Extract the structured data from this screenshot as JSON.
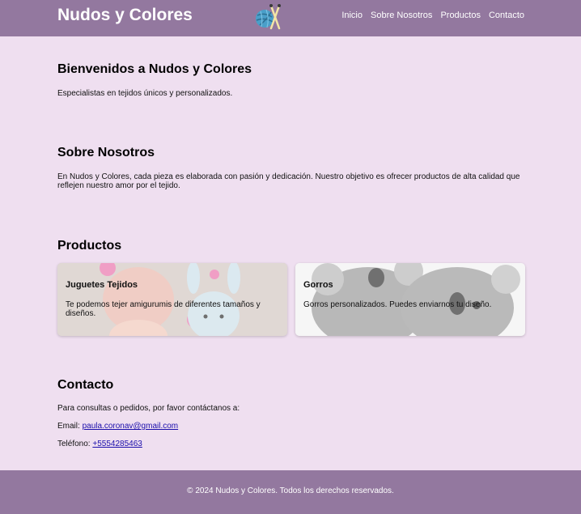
{
  "header": {
    "brand": "Nudos y Colores",
    "logo_icon": "yarn-ball-needles-icon",
    "nav": [
      {
        "label": "Inicio"
      },
      {
        "label": "Sobre Nosotros"
      },
      {
        "label": "Productos"
      },
      {
        "label": "Contacto"
      }
    ]
  },
  "hero": {
    "title": "Bienvenidos a Nudos y Colores",
    "text": "Especialistas en tejidos únicos y personalizados."
  },
  "about": {
    "title": "Sobre Nosotros",
    "text": "En Nudos y Colores, cada pieza es elaborada con pasión y dedicación. Nuestro objetivo es ofrecer productos de alta calidad que reflejen nuestro amor por el tejido."
  },
  "products": {
    "title": "Productos",
    "items": [
      {
        "title": "Juguetes Tejidos",
        "text": "Te podemos tejer amigurumis de diferentes tamaños y diseños."
      },
      {
        "title": "Gorros",
        "text": "Gorros personalizados. Puedes enviarnos tu diseño."
      }
    ]
  },
  "contact": {
    "title": "Contacto",
    "intro": "Para consultas o pedidos, por favor contáctanos a:",
    "email_label": "Email:",
    "email": "paula.coronav@gmail.com",
    "phone_label": "Teléfono:",
    "phone": "+5554285463"
  },
  "footer": {
    "text": "© 2024 Nudos y Colores. Todos los derechos reservados."
  },
  "colors": {
    "header_bg": "#93789f",
    "page_bg": "#efdff0",
    "link": "#1a0dab"
  }
}
